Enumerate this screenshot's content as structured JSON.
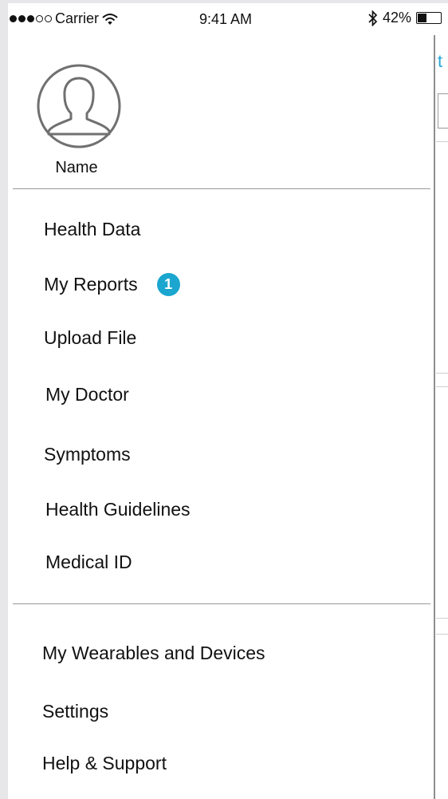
{
  "status_bar": {
    "carrier": "Carrier",
    "time": "9:41 AM",
    "battery_percent": "42%",
    "battery_level": 0.42,
    "signal_bars_filled": 3,
    "signal_bars_total": 5
  },
  "profile": {
    "name": "Name"
  },
  "menu": {
    "primary": [
      {
        "label": "Health Data"
      },
      {
        "label": "My Reports",
        "badge": "1"
      },
      {
        "label": "Upload File"
      },
      {
        "label": "My Doctor"
      },
      {
        "label": "Symptoms"
      },
      {
        "label": "Health Guidelines"
      },
      {
        "label": "Medical ID"
      }
    ],
    "secondary": [
      {
        "label": "My Wearables and Devices"
      },
      {
        "label": "Settings"
      },
      {
        "label": "Help & Support"
      }
    ]
  },
  "background_screen": {
    "partial_text": "t"
  },
  "colors": {
    "accent": "#1ba6cf",
    "link": "#29a8d8"
  }
}
